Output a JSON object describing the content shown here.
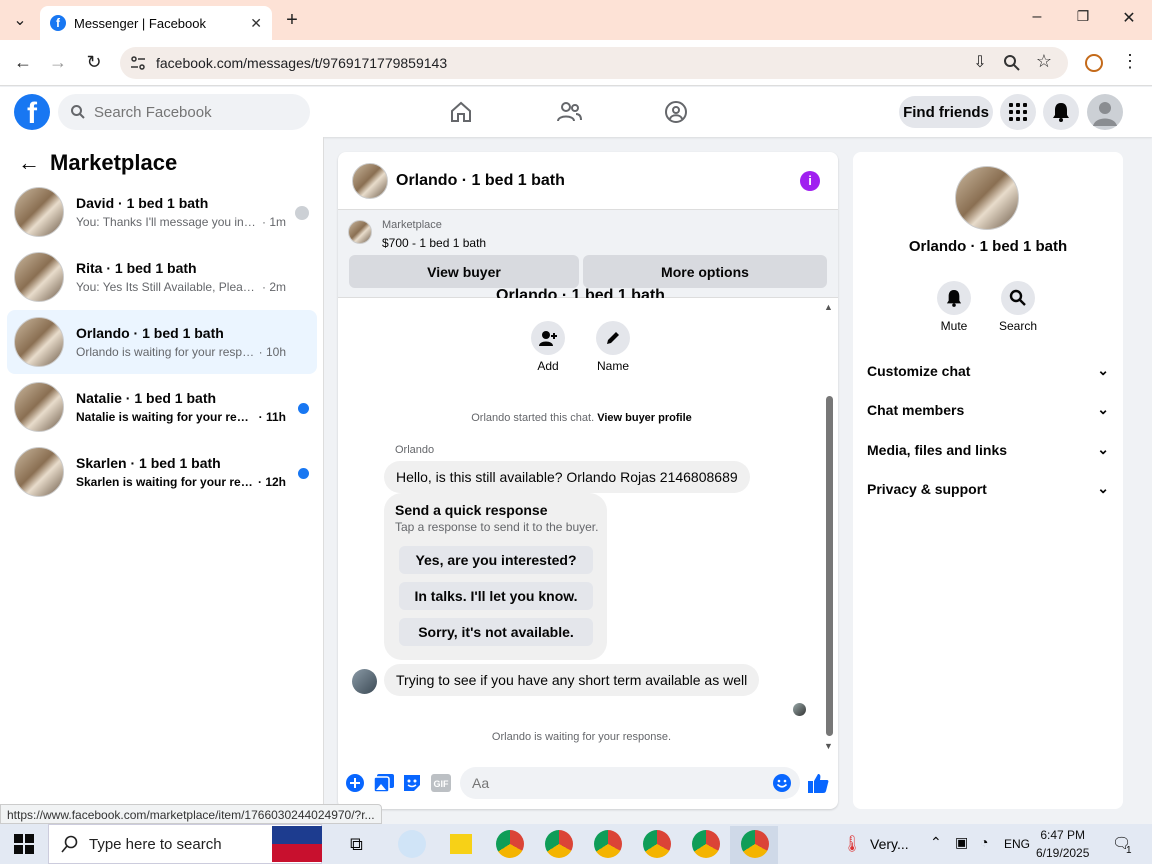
{
  "browser": {
    "tab_title": "Messenger | Facebook",
    "url": "facebook.com/messages/t/9769171779859143",
    "status_url": "https://www.facebook.com/marketplace/item/1766030244024970/?r..."
  },
  "fb": {
    "search_placeholder": "Search Facebook",
    "find_friends": "Find friends",
    "brand_color": "#1877f2"
  },
  "sidebar": {
    "title": "Marketplace",
    "conversations": [
      {
        "name": "David · 1 bed 1 bath",
        "preview": "You: Thanks I'll message you in a ...",
        "time": "· 1m",
        "unread": false
      },
      {
        "name": "Rita · 1 bed 1 bath",
        "preview": "You: Yes Its Still Available, Please Sen...",
        "time": "· 2m",
        "unread": false
      },
      {
        "name": "Orlando · 1 bed 1 bath",
        "preview": "Orlando is waiting for your response.",
        "time": "· 10h",
        "unread": false
      },
      {
        "name": "Natalie · 1 bed 1 bath",
        "preview": "Natalie is waiting for your respon...",
        "time": "· 11h",
        "unread": true
      },
      {
        "name": "Skarlen · 1 bed 1 bath",
        "preview": "Skarlen is waiting for your respo...",
        "time": "· 12h",
        "unread": true
      }
    ]
  },
  "chat": {
    "title": "Orlando · 1 bed 1 bath",
    "banner_source": "Marketplace",
    "banner_listing": "$700 - 1 bed 1 bath",
    "view_buyer": "View buyer",
    "more_options": "More options",
    "cut_title": "Orlando · 1 bed 1 bath",
    "add_label": "Add",
    "name_label": "Name",
    "started_text": "Orlando started this chat.",
    "view_profile": "View buyer profile",
    "sender": "Orlando",
    "msg1": "Hello, is this still available? Orlando Rojas 2146808689",
    "qr_title": "Send a quick response",
    "qr_sub": "Tap a response to send it to the buyer.",
    "qr_options": [
      "Yes, are you interested?",
      "In talks. I'll let you know.",
      "Sorry, it's not available."
    ],
    "msg2": "Trying to see if you have any short term available as well",
    "waiting": "Orlando is waiting for your response.",
    "composer_placeholder": "Aa"
  },
  "details": {
    "title": "Orlando · 1 bed 1 bath",
    "mute": "Mute",
    "search": "Search",
    "sections": [
      "Customize chat",
      "Chat members",
      "Media, files and links",
      "Privacy & support"
    ]
  },
  "taskbar": {
    "search_placeholder": "Type here to search",
    "weather": "Very...",
    "lang": "ENG",
    "time": "6:47 PM",
    "date": "6/19/2025",
    "notif_count": "1"
  }
}
